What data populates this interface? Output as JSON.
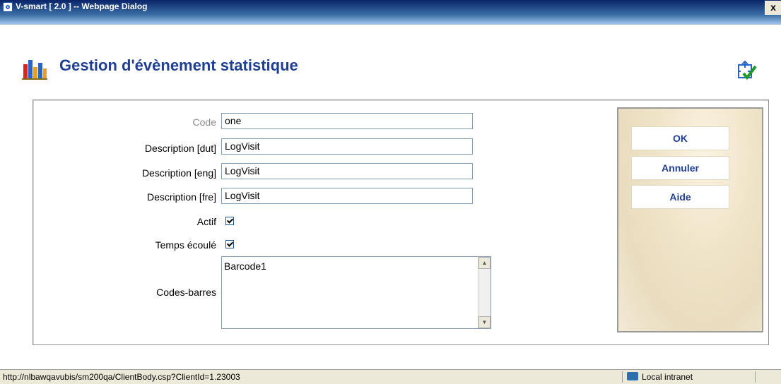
{
  "window": {
    "title": "V-smart [ 2.0 ] -- Webpage Dialog",
    "close_label": "x"
  },
  "header": {
    "title": "Gestion d'évènement statistique",
    "icon": "bar-chart-icon",
    "corner_icon": "check-move-icon"
  },
  "form": {
    "code": {
      "label": "Code",
      "value": "one"
    },
    "desc_dut": {
      "label": "Description [dut]",
      "value": "LogVisit"
    },
    "desc_eng": {
      "label": "Description [eng]",
      "value": "LogVisit"
    },
    "desc_fre": {
      "label": "Description [fre]",
      "value": "LogVisit"
    },
    "actif": {
      "label": "Actif",
      "checked": true
    },
    "temps": {
      "label": "Temps écoulé",
      "checked": true
    },
    "barcodes": {
      "label": "Codes-barres",
      "value": "Barcode1"
    }
  },
  "buttons": {
    "ok": "OK",
    "annuler": "Annuler",
    "aide": "Aide"
  },
  "status": {
    "url": "http://nlbawqavubis/sm200qa/ClientBody.csp?ClientId=1.23003",
    "zone": "Local intranet"
  },
  "colors": {
    "title": "#1f3f95",
    "titlebar": "#0a246a"
  }
}
